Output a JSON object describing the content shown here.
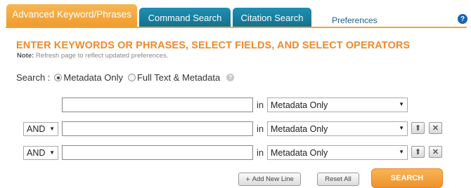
{
  "tabs": [
    {
      "label": "Advanced Keyword/Phrases",
      "active": true
    },
    {
      "label": "Command Search",
      "active": false
    },
    {
      "label": "Citation Search",
      "active": false
    }
  ],
  "preferences_label": "Preferences",
  "help_glyph": "?",
  "heading": "ENTER KEYWORDS OR PHRASES, SELECT FIELDS, AND SELECT OPERATORS",
  "note": {
    "label": "Note:",
    "text": " Refresh page to reflect updated preferences."
  },
  "search_scope": {
    "label": "Search :",
    "options": [
      {
        "label": "Metadata Only",
        "selected": true
      },
      {
        "label": "Full Text & Metadata",
        "selected": false
      }
    ],
    "help_glyph": "?"
  },
  "rows": [
    {
      "operator": "",
      "value": "",
      "in_label": "in",
      "field": "Metadata Only"
    },
    {
      "operator": "AND",
      "value": "",
      "in_label": "in",
      "field": "Metadata Only"
    },
    {
      "operator": "AND",
      "value": "",
      "in_label": "in",
      "field": "Metadata Only"
    }
  ],
  "buttons": {
    "add_new_line": "Add New Line",
    "reset_all": "Reset All",
    "search": "SEARCH"
  },
  "colors": {
    "accent_orange": "#ee9a2c",
    "tab_blue": "#156f8e"
  },
  "icons": {
    "move_up": "arrow-up-icon",
    "remove": "close-icon",
    "dropdown": "caret-down-icon"
  }
}
